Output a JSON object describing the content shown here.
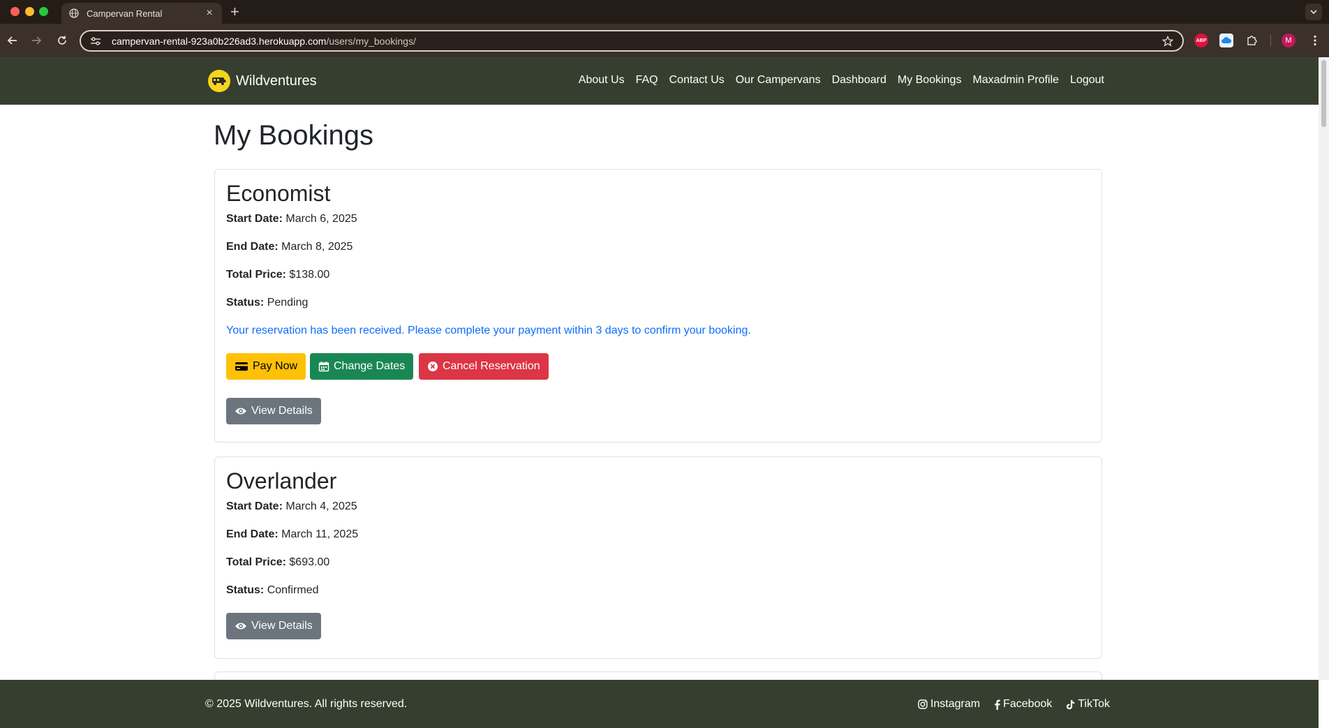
{
  "browser": {
    "tab_title": "Campervan Rental",
    "url_host": "campervan-rental-923a0b226ad3.herokuapp.com",
    "url_path": "/users/my_bookings/",
    "abp_label": "ABP",
    "profile_initial": "M"
  },
  "site": {
    "brand": "Wildventures",
    "nav": [
      {
        "label": "About Us"
      },
      {
        "label": "FAQ"
      },
      {
        "label": "Contact Us"
      },
      {
        "label": "Our Campervans"
      },
      {
        "label": "Dashboard"
      },
      {
        "label": "My Bookings"
      },
      {
        "label": "Maxadmin Profile"
      },
      {
        "label": "Logout"
      }
    ]
  },
  "page": {
    "title": "My Bookings"
  },
  "labels": {
    "start_date": "Start Date:",
    "end_date": "End Date:",
    "total_price": "Total Price:",
    "status": "Status:"
  },
  "bookings": [
    {
      "name": "Economist",
      "start_date": "March 6, 2025",
      "end_date": "March 8, 2025",
      "total_price": "$138.00",
      "status": "Pending",
      "message": "Your reservation has been received. Please complete your payment within 3 days to confirm your booking.",
      "pay_label": "Pay Now",
      "change_label": "Change Dates",
      "cancel_label": "Cancel Reservation",
      "details_label": "View Details"
    },
    {
      "name": "Overlander",
      "start_date": "March 4, 2025",
      "end_date": "March 11, 2025",
      "total_price": "$693.00",
      "status": "Confirmed",
      "details_label": "View Details"
    }
  ],
  "footer": {
    "copyright": "© 2025 Wildventures. All rights reserved.",
    "social": [
      {
        "label": "Instagram",
        "icon": "instagram-icon"
      },
      {
        "label": "Facebook",
        "icon": "facebook-icon"
      },
      {
        "label": "TikTok",
        "icon": "tiktok-icon"
      }
    ]
  },
  "colors": {
    "nav_bg": "#363f2f",
    "brand_logo": "#f7d51d",
    "pay_button": "#ffc107",
    "change_button": "#198754",
    "cancel_button": "#dc3545",
    "details_button": "#6c757d",
    "info_text": "#0d6efd"
  }
}
